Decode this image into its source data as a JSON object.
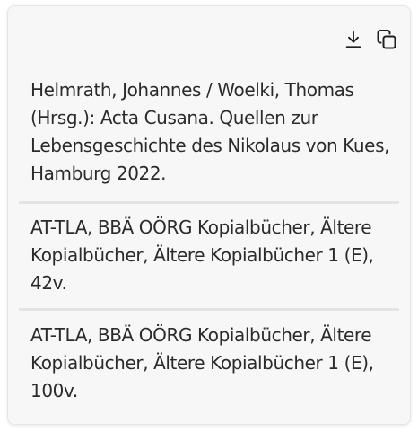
{
  "toolbar": {
    "download_icon": "download-icon",
    "copy_icon": "copy-icon"
  },
  "citations": [
    {
      "text": "Helmrath, Johannes / Woelki, Thomas (Hrsg.): Acta Cusana. Quellen zur Lebensgeschichte des Nikolaus von Kues, Hamburg 2022."
    },
    {
      "text": "AT-TLA, BBÄ OÖRG Kopialbücher, Ältere Kopialbücher, Ältere Kopialbücher 1 (E), 42v."
    },
    {
      "text": "AT-TLA, BBÄ OÖRG Kopialbücher, Ältere Kopialbücher, Ältere Kopialbücher 1 (E), 100v."
    }
  ],
  "colors": {
    "card_background": "#f7f7f7",
    "text": "#2b2b2b",
    "divider": "#e4e4e4"
  }
}
